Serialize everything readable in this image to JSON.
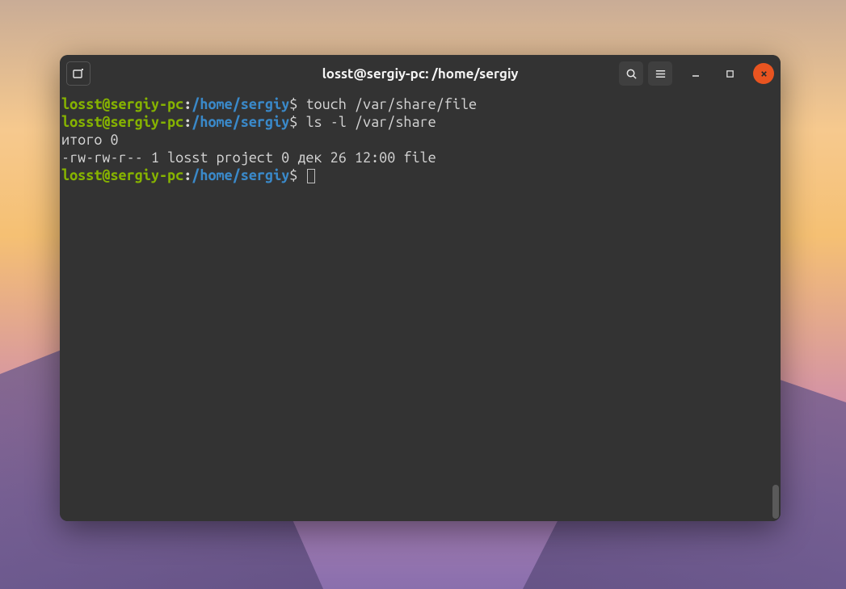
{
  "window": {
    "title": "losst@sergiy-pc: /home/sergiy"
  },
  "prompt": {
    "user_host": "losst@sergiy-pc",
    "colon": ":",
    "path": "/home/sergiy",
    "symbol": "$"
  },
  "lines": [
    {
      "type": "prompt",
      "command": "touch /var/share/file"
    },
    {
      "type": "prompt",
      "command": "ls -l /var/share"
    },
    {
      "type": "output",
      "text": "итого 0"
    },
    {
      "type": "output",
      "text": "-rw-rw-r-- 1 losst project 0 дек 26 12:00 file"
    },
    {
      "type": "prompt",
      "command": ""
    }
  ],
  "icons": {
    "new_tab": "new-tab-icon",
    "search": "search-icon",
    "menu": "hamburger-icon",
    "minimize": "minimize-icon",
    "maximize": "maximize-icon",
    "close": "close-icon"
  }
}
